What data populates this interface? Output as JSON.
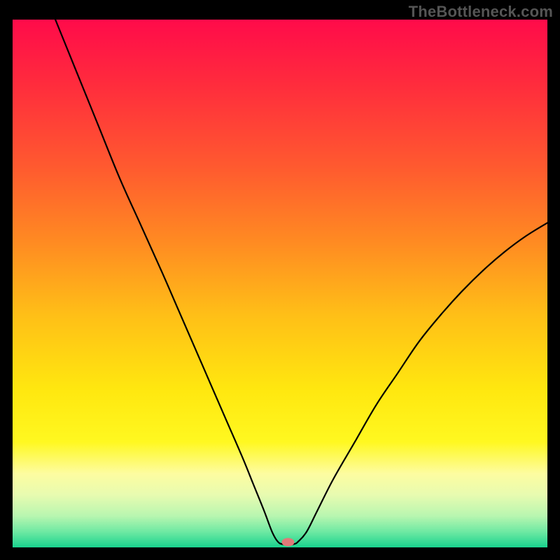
{
  "watermark": "TheBottleneck.com",
  "chart_data": {
    "type": "line",
    "title": "",
    "xlabel": "",
    "ylabel": "",
    "xlim": [
      0,
      100
    ],
    "ylim": [
      0,
      100
    ],
    "grid": false,
    "legend": false,
    "annotations": [],
    "background_gradient": {
      "stops": [
        {
          "offset": 0.0,
          "color": "#ff0b4a"
        },
        {
          "offset": 0.12,
          "color": "#ff2b3d"
        },
        {
          "offset": 0.28,
          "color": "#ff5a2f"
        },
        {
          "offset": 0.42,
          "color": "#ff8a22"
        },
        {
          "offset": 0.56,
          "color": "#ffbf17"
        },
        {
          "offset": 0.7,
          "color": "#ffe70f"
        },
        {
          "offset": 0.8,
          "color": "#fff820"
        },
        {
          "offset": 0.86,
          "color": "#fdfca0"
        },
        {
          "offset": 0.9,
          "color": "#e8fbb0"
        },
        {
          "offset": 0.94,
          "color": "#b9f6b0"
        },
        {
          "offset": 0.97,
          "color": "#6fe9a3"
        },
        {
          "offset": 1.0,
          "color": "#19d38e"
        }
      ]
    },
    "marker": {
      "x": 51.5,
      "y": 1.0,
      "color": "#e07a78"
    },
    "series": [
      {
        "name": "curve",
        "color": "#000000",
        "width": 2.2,
        "points": [
          {
            "x": 8.0,
            "y": 100.0
          },
          {
            "x": 12.0,
            "y": 90.0
          },
          {
            "x": 16.0,
            "y": 80.0
          },
          {
            "x": 20.0,
            "y": 70.0
          },
          {
            "x": 24.0,
            "y": 61.0
          },
          {
            "x": 28.0,
            "y": 52.0
          },
          {
            "x": 31.0,
            "y": 45.0
          },
          {
            "x": 34.0,
            "y": 38.0
          },
          {
            "x": 37.0,
            "y": 31.0
          },
          {
            "x": 40.0,
            "y": 24.0
          },
          {
            "x": 43.0,
            "y": 17.0
          },
          {
            "x": 45.0,
            "y": 12.0
          },
          {
            "x": 47.0,
            "y": 7.0
          },
          {
            "x": 48.5,
            "y": 3.0
          },
          {
            "x": 49.5,
            "y": 1.2
          },
          {
            "x": 50.5,
            "y": 0.6
          },
          {
            "x": 52.5,
            "y": 0.6
          },
          {
            "x": 53.5,
            "y": 1.2
          },
          {
            "x": 55.0,
            "y": 3.0
          },
          {
            "x": 57.0,
            "y": 7.0
          },
          {
            "x": 60.0,
            "y": 13.0
          },
          {
            "x": 64.0,
            "y": 20.0
          },
          {
            "x": 68.0,
            "y": 27.0
          },
          {
            "x": 72.0,
            "y": 33.0
          },
          {
            "x": 76.0,
            "y": 39.0
          },
          {
            "x": 80.0,
            "y": 44.0
          },
          {
            "x": 84.0,
            "y": 48.5
          },
          {
            "x": 88.0,
            "y": 52.5
          },
          {
            "x": 92.0,
            "y": 56.0
          },
          {
            "x": 96.0,
            "y": 59.0
          },
          {
            "x": 100.0,
            "y": 61.5
          }
        ]
      }
    ]
  }
}
